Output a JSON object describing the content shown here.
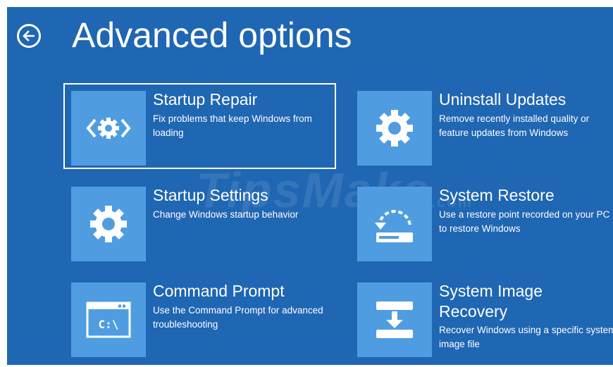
{
  "header": {
    "title": "Advanced options",
    "back_icon": "arrow-left-icon"
  },
  "watermark": {
    "text": "TipsMake",
    "suffix": ".com"
  },
  "options": [
    {
      "title": "Startup Repair",
      "desc": "Fix problems that keep Windows from loading",
      "icon": "code-gear-icon",
      "selected": true
    },
    {
      "title": "Uninstall Updates",
      "desc": "Remove recently installed quality or feature updates from Windows",
      "icon": "gear-icon"
    },
    {
      "title": "Startup Settings",
      "desc": "Change Windows startup behavior",
      "icon": "gear-icon"
    },
    {
      "title": "System Restore",
      "desc": "Use a restore point recorded on your PC to restore Windows",
      "icon": "restore-drive-icon"
    },
    {
      "title": "Command Prompt",
      "desc": "Use the Command Prompt for advanced troubleshooting",
      "icon": "command-prompt-icon",
      "icon_text": "C:\\"
    },
    {
      "title_line1": "System Image",
      "title_line2": "Recovery",
      "desc": "Recover Windows using a specific system image file",
      "icon": "system-image-icon"
    }
  ],
  "colors": {
    "background": "#1f66b3",
    "tile": "#4f9de0",
    "text": "#ffffff"
  }
}
